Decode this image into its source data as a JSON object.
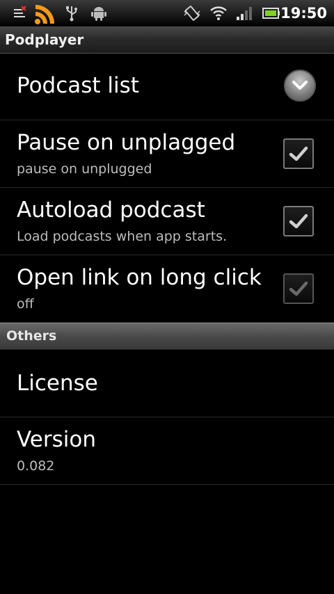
{
  "status_bar": {
    "time": "19:50",
    "icons": [
      "notification-list-icon",
      "rss-icon",
      "usb-icon",
      "android-icon",
      "vibrate-icon",
      "wifi-icon",
      "signal-icon",
      "battery-icon"
    ]
  },
  "app": {
    "title": "Podplayer"
  },
  "preferences": [
    {
      "title": "Podcast list",
      "summary": "",
      "widget": "dropdown"
    },
    {
      "title": "Pause on unplagged",
      "summary": "pause on unplugged",
      "widget": "checkbox",
      "checked": true,
      "enabled": true
    },
    {
      "title": "Autoload podcast",
      "summary": "Load podcasts when app starts.",
      "widget": "checkbox",
      "checked": true,
      "enabled": true
    },
    {
      "title": "Open link on long click",
      "summary": "off",
      "widget": "checkbox",
      "checked": true,
      "enabled": false
    }
  ],
  "category": {
    "title": "Others"
  },
  "others": [
    {
      "title": "License",
      "summary": ""
    },
    {
      "title": "Version",
      "summary": "0.082"
    }
  ],
  "colors": {
    "background": "#000000",
    "summary_text": "#bdbdbd",
    "rss_orange": "#f39a1c",
    "battery_green": "#7fd21f"
  }
}
